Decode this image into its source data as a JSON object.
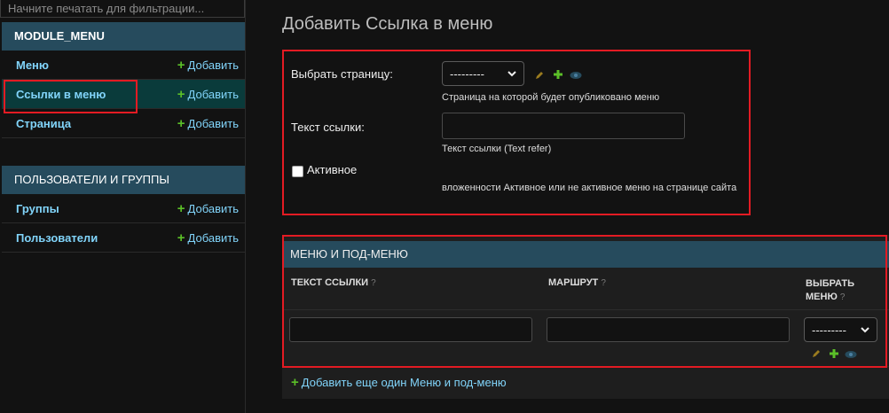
{
  "sidebar": {
    "filter_placeholder": "Начните печатать для фильтрации...",
    "modules": [
      {
        "title": "MODULE_MENU",
        "rows": [
          {
            "name": "Меню",
            "add": "Добавить"
          },
          {
            "name": "Ссылки в меню",
            "add": "Добавить"
          },
          {
            "name": "Страница",
            "add": "Добавить"
          }
        ]
      },
      {
        "title": "ПОЛЬЗОВАТЕЛИ И ГРУППЫ",
        "rows": [
          {
            "name": "Группы",
            "add": "Добавить"
          },
          {
            "name": "Пользователи",
            "add": "Добавить"
          }
        ]
      }
    ]
  },
  "main": {
    "title": "Добавить Ссылка в меню",
    "form": {
      "page_label": "Выбрать страницу:",
      "page_select_value": "---------",
      "page_help": "Страница на которой будет опубликовано меню",
      "link_text_label": "Текст ссылки:",
      "link_text_value": "",
      "link_text_help": "Текст ссылки (Text refer)",
      "active_label": "Активное",
      "active_checked": false,
      "active_help": "вложенности Активное или не активное меню на странице сайта"
    },
    "inline": {
      "title": "МЕНЮ И ПОД-МЕНЮ",
      "columns": [
        "ТЕКСТ ССЫЛКИ",
        "МАРШРУТ",
        "ВЫБРАТЬ",
        "МЕНЮ"
      ],
      "row": {
        "link_text": "",
        "route": "",
        "menu_select_value": "---------"
      },
      "add_another": "Добавить еще один Меню и под-меню"
    }
  },
  "colors": {
    "accent": "#81d4fa",
    "header_bg": "#264b5d",
    "selected_row": "#0a3b3b",
    "add_plus": "#5bbf28",
    "highlight_red": "#e31b23"
  },
  "icons": [
    "plus-icon",
    "pencil-icon",
    "eye-icon",
    "help-icon",
    "chevron-down-icon"
  ]
}
